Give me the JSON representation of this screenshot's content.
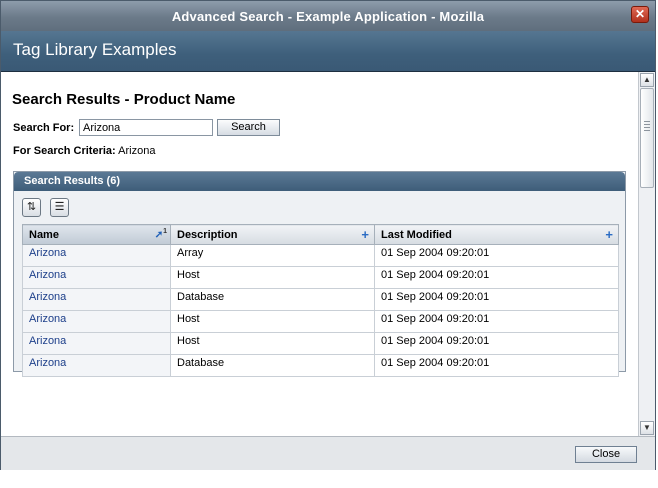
{
  "window": {
    "title": "Advanced Search - Example Application - Mozilla",
    "close_glyph": "✕"
  },
  "app": {
    "title": "Tag Library Examples"
  },
  "page": {
    "title": "Search Results - Product Name",
    "search_label": "Search For:",
    "search_value": "Arizona",
    "search_button": "Search",
    "criteria_label": "For Search Criteria:",
    "criteria_value": "Arizona"
  },
  "results": {
    "header": "Search Results (6)",
    "toolbar": [
      {
        "icon": "sort-icon",
        "glyph": "⇅"
      },
      {
        "icon": "text-view-icon",
        "glyph": "☰"
      }
    ],
    "columns": [
      {
        "label": "Name",
        "indicator": "sort-ascending",
        "sort_rank": "1"
      },
      {
        "label": "Description",
        "indicator": "add-sort"
      },
      {
        "label": "Last Modified",
        "indicator": "add-sort"
      }
    ],
    "rows": [
      {
        "name": "Arizona",
        "description": "Array",
        "modified": "01 Sep 2004 09:20:01"
      },
      {
        "name": "Arizona",
        "description": "Host",
        "modified": "01 Sep 2004 09:20:01"
      },
      {
        "name": "Arizona",
        "description": "Database",
        "modified": "01 Sep 2004 09:20:01"
      },
      {
        "name": "Arizona",
        "description": "Host",
        "modified": "01 Sep 2004 09:20:01"
      },
      {
        "name": "Arizona",
        "description": "Host",
        "modified": "01 Sep 2004 09:20:01"
      },
      {
        "name": "Arizona",
        "description": "Database",
        "modified": "01 Sep 2004 09:20:01"
      }
    ]
  },
  "footer": {
    "close_button": "Close"
  }
}
